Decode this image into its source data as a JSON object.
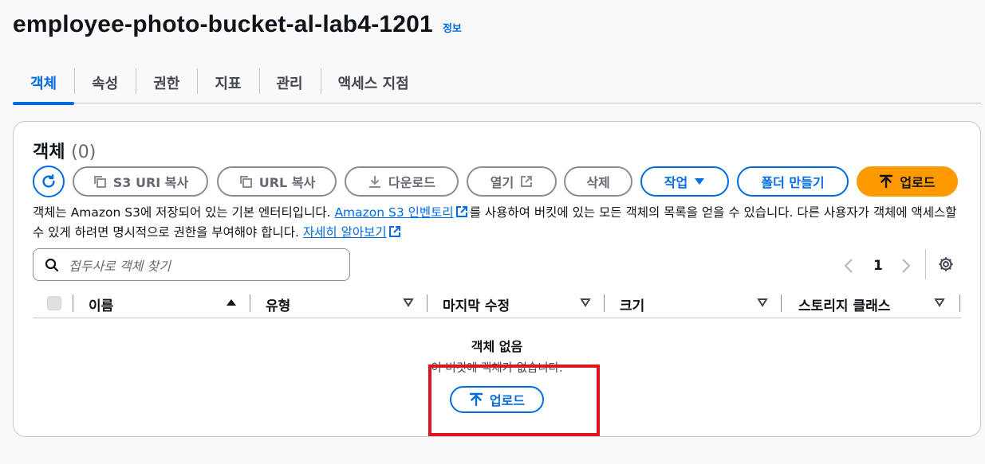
{
  "header": {
    "title": "employee-photo-bucket-al-lab4-1201",
    "info_label": "정보"
  },
  "tabs": [
    {
      "label": "객체",
      "active": true
    },
    {
      "label": "속성"
    },
    {
      "label": "권한"
    },
    {
      "label": "지표"
    },
    {
      "label": "관리"
    },
    {
      "label": "액세스 지점"
    }
  ],
  "objects_panel": {
    "title": "객체",
    "count": "(0)",
    "toolbar": {
      "copy_s3_uri": "S3 URI 복사",
      "copy_url": "URL 복사",
      "download": "다운로드",
      "open": "열기",
      "delete": "삭제",
      "actions": "작업",
      "create_folder": "폴더 만들기",
      "upload": "업로드"
    },
    "description": {
      "part1": "객체는 Amazon S3에 저장되어 있는 기본 엔터티입니다. ",
      "inventory_link": "Amazon S3 인벤토리",
      "part2": "를 사용하여 버킷에 있는 모든 객체의 목록을 얻을 수 있습니다. 다른 사용자가 객체에 액세스할 수 있게 하려면 명시적으로 권한을 부여해야 합니다. ",
      "learn_more_link": "자세히 알아보기"
    },
    "search": {
      "placeholder": "접두사로 객체 찾기"
    },
    "pagination": {
      "current_page": "1"
    },
    "table": {
      "columns": [
        "이름",
        "유형",
        "마지막 수정",
        "크기",
        "스토리지 클래스"
      ]
    },
    "empty_state": {
      "title": "객체 없음",
      "description": "이 버킷에 객체가 없습니다.",
      "upload_label": "업로드"
    }
  },
  "colors": {
    "accent": "#006ce0",
    "primary_button": "#ff9900",
    "highlight_box": "#e0141e"
  }
}
